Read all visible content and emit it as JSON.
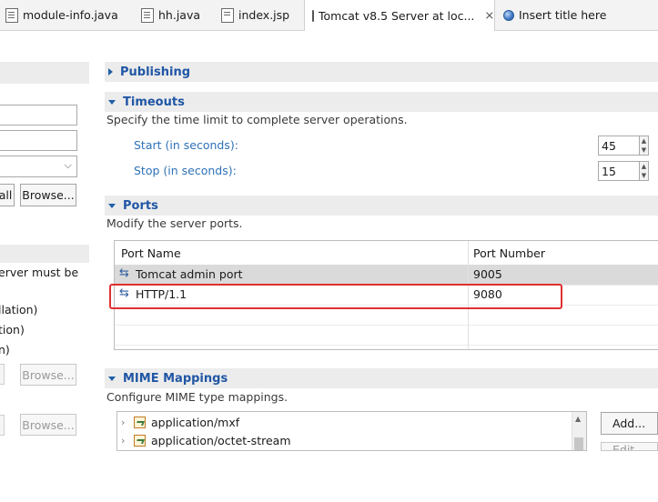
{
  "tabs": [
    {
      "label": "module-info.java",
      "icon": "java-file-icon"
    },
    {
      "label": "hh.java",
      "icon": "java-file-icon"
    },
    {
      "label": "index.jsp",
      "icon": "jsp-file-icon"
    },
    {
      "label": "Tomcat v8.5 Server at loc...",
      "icon": "tomcat-server-icon",
      "active": true
    },
    {
      "label": "Insert title here",
      "icon": "globe-icon"
    }
  ],
  "left_panel": {
    "browse_label_1": "Browse...",
    "clipped_button": "all",
    "server_text": "erver must be",
    "lines": [
      "llation)",
      "tion)",
      "n)"
    ],
    "browse_label_2": "Browse...",
    "browse_label_3": "Browse..."
  },
  "publishing": {
    "title": "Publishing"
  },
  "timeouts": {
    "title": "Timeouts",
    "description": "Specify the time limit to complete server operations.",
    "start_label": "Start (in seconds):",
    "start_value": "45",
    "stop_label": "Stop (in seconds):",
    "stop_value": "15"
  },
  "ports": {
    "title": "Ports",
    "description": "Modify the server ports.",
    "columns": [
      "Port Name",
      "Port Number"
    ],
    "rows": [
      {
        "name": "Tomcat admin port",
        "number": "9005"
      },
      {
        "name": "HTTP/1.1",
        "number": "9080"
      }
    ]
  },
  "mime": {
    "title": "MIME Mappings",
    "description": "Configure MIME type mappings.",
    "items": [
      "application/mxf",
      "application/octet-stream"
    ],
    "add_label": "Add...",
    "edit_label": "Edit..."
  },
  "colors": {
    "section_title": "#2056a5",
    "field_label": "#2e72b8",
    "highlight": "#e03030"
  }
}
